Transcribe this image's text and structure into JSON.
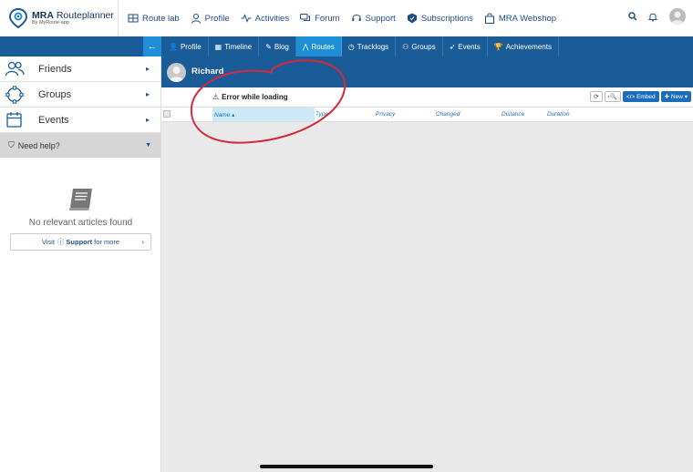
{
  "app": {
    "title_main": "MRA",
    "title_rest": " Routeplanner",
    "subtitle": "By MyRoute-app"
  },
  "topnav": [
    {
      "label": "Route lab",
      "icon": "route-lab-icon"
    },
    {
      "label": "Profile",
      "icon": "person-icon"
    },
    {
      "label": "Activities",
      "icon": "activity-icon"
    },
    {
      "label": "Forum",
      "icon": "chat-icon"
    },
    {
      "label": "Support",
      "icon": "headset-icon"
    },
    {
      "label": "Subscriptions",
      "icon": "badge-icon"
    },
    {
      "label": "MRA Webshop",
      "icon": "bag-icon"
    }
  ],
  "subtabs": [
    {
      "label": "Profile",
      "icon": "person-icon",
      "glyph": "👤"
    },
    {
      "label": "Timeline",
      "icon": "calendar-icon",
      "glyph": "▦"
    },
    {
      "label": "Blog",
      "icon": "pencil-icon",
      "glyph": "✎"
    },
    {
      "label": "Routes",
      "icon": "road-icon",
      "glyph": "⋀"
    },
    {
      "label": "Tracklogs",
      "icon": "clock-icon",
      "glyph": "◷"
    },
    {
      "label": "Groups",
      "icon": "users-icon",
      "glyph": "⚇"
    },
    {
      "label": "Events",
      "icon": "rocket-icon",
      "glyph": "➶"
    },
    {
      "label": "Achievements",
      "icon": "trophy-icon",
      "glyph": "🏆"
    }
  ],
  "sidebar": {
    "items": [
      {
        "label": "Friends",
        "icon": "friends-icon"
      },
      {
        "label": "Groups",
        "icon": "groups-icon"
      },
      {
        "label": "Events",
        "icon": "calendar-icon"
      }
    ],
    "help_label": "Need help?",
    "no_articles": "No relevant articles found",
    "support_visit": "Visit",
    "support_link": "Support",
    "support_more": "for more"
  },
  "main": {
    "user_name": "Richard",
    "error_text": "Error while loading",
    "buttons": {
      "refresh": "⟳",
      "search": "‹🔍",
      "embed": "</> Embed",
      "new": "✚ New ▾"
    },
    "columns": [
      "Name",
      "Type",
      "Privacy",
      "Changed",
      "Distance",
      "Duration"
    ]
  },
  "colors": {
    "nav_blue": "#1a5c97",
    "active_blue": "#1e8fd6",
    "annotation_red": "#d8283a"
  }
}
